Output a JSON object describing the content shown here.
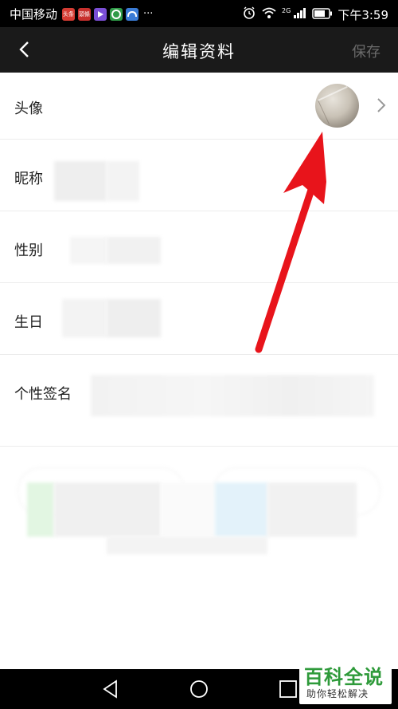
{
  "status_bar": {
    "carrier": "中国移动",
    "app_icons": [
      {
        "name": "toutiao-icon",
        "label": "头条",
        "color": "#d43c33"
      },
      {
        "name": "news-icon",
        "label": "頭條",
        "color": "#c8302d"
      },
      {
        "name": "video-icon",
        "label": "",
        "color": "#7b4fd6"
      },
      {
        "name": "browser-icon",
        "label": "",
        "color": "#2f9b48"
      },
      {
        "name": "cloud-icon",
        "label": "",
        "color": "#3a7bd5"
      }
    ],
    "more": "···",
    "network": "2G",
    "time": "下午3:59"
  },
  "nav": {
    "title": "编辑资料",
    "save_label": "保存"
  },
  "profile": {
    "avatar_label": "头像",
    "nickname_label": "昵称",
    "gender_label": "性别",
    "birthday_label": "生日",
    "signature_label": "个性签名"
  },
  "watermark": {
    "title": "百科全说",
    "subtitle": "助你轻松解决"
  },
  "colors": {
    "nav_bg": "#1a1a1a",
    "arrow_red": "#e8141b",
    "watermark_green": "#2e9a3a"
  }
}
